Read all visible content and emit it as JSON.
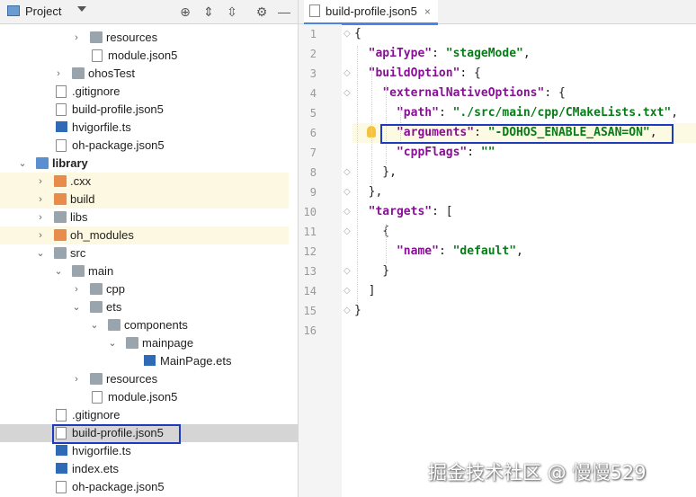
{
  "project_panel": {
    "title": "Project",
    "tree": [
      {
        "label": "resources",
        "type": "folder-grey",
        "arrow": "›"
      },
      {
        "label": "module.json5",
        "type": "json"
      },
      {
        "label": "ohosTest",
        "type": "folder-grey",
        "arrow": "›"
      },
      {
        "label": ".gitignore",
        "type": "git"
      },
      {
        "label": "build-profile.json5",
        "type": "json"
      },
      {
        "label": "hvigorfile.ts",
        "type": "ts"
      },
      {
        "label": "oh-package.json5",
        "type": "json"
      },
      {
        "label": "library",
        "type": "folder-blue",
        "arrow": "⌄",
        "bold": true
      },
      {
        "label": ".cxx",
        "type": "folder-orange",
        "arrow": "›",
        "highlight": true
      },
      {
        "label": "build",
        "type": "folder-orange",
        "arrow": "›",
        "highlight": true
      },
      {
        "label": "libs",
        "type": "folder-grey",
        "arrow": "›"
      },
      {
        "label": "oh_modules",
        "type": "folder-orange",
        "arrow": "›",
        "highlight": true
      },
      {
        "label": "src",
        "type": "folder-grey",
        "arrow": "⌄"
      },
      {
        "label": "main",
        "type": "folder-grey",
        "arrow": "⌄"
      },
      {
        "label": "cpp",
        "type": "folder-grey",
        "arrow": "›"
      },
      {
        "label": "ets",
        "type": "folder-grey",
        "arrow": "⌄"
      },
      {
        "label": "components",
        "type": "folder-grey",
        "arrow": "⌄"
      },
      {
        "label": "mainpage",
        "type": "folder-grey",
        "arrow": "⌄"
      },
      {
        "label": "MainPage.ets",
        "type": "ets"
      },
      {
        "label": "resources",
        "type": "folder-grey",
        "arrow": "›"
      },
      {
        "label": "module.json5",
        "type": "json"
      },
      {
        "label": ".gitignore",
        "type": "git"
      },
      {
        "label": "build-profile.json5",
        "type": "json",
        "selected": true
      },
      {
        "label": "hvigorfile.ts",
        "type": "ts"
      },
      {
        "label": "index.ets",
        "type": "ets"
      },
      {
        "label": "oh-package.json5",
        "type": "json"
      }
    ]
  },
  "editor": {
    "tab_label": "build-profile.json5",
    "tab_close": "×",
    "line_numbers": [
      "1",
      "2",
      "3",
      "4",
      "5",
      "6",
      "7",
      "8",
      "9",
      "10",
      "11",
      "12",
      "13",
      "14",
      "15",
      "16"
    ],
    "lines": [
      [
        {
          "t": "{",
          "c": "p"
        }
      ],
      [
        {
          "t": "  ",
          "c": "p"
        },
        {
          "t": "\"apiType\"",
          "c": "key"
        },
        {
          "t": ": ",
          "c": "p"
        },
        {
          "t": "\"stageMode\"",
          "c": "str"
        },
        {
          "t": ",",
          "c": "p"
        }
      ],
      [
        {
          "t": "  ",
          "c": "p"
        },
        {
          "t": "\"buildOption\"",
          "c": "key"
        },
        {
          "t": ": {",
          "c": "p"
        }
      ],
      [
        {
          "t": "    ",
          "c": "p"
        },
        {
          "t": "\"externalNativeOptions\"",
          "c": "key"
        },
        {
          "t": ": {",
          "c": "p"
        }
      ],
      [
        {
          "t": "      ",
          "c": "p"
        },
        {
          "t": "\"path\"",
          "c": "key"
        },
        {
          "t": ": ",
          "c": "p"
        },
        {
          "t": "\"./src/main/cpp/CMakeLists.txt\"",
          "c": "str"
        },
        {
          "t": ",",
          "c": "p"
        }
      ],
      [
        {
          "t": "      ",
          "c": "p"
        },
        {
          "t": "\"arguments\"",
          "c": "key"
        },
        {
          "t": ": ",
          "c": "p"
        },
        {
          "t": "\"-DOHOS_ENABLE_ASAN=ON\"",
          "c": "str"
        },
        {
          "t": ",",
          "c": "p"
        }
      ],
      [
        {
          "t": "      ",
          "c": "p"
        },
        {
          "t": "\"cppFlags\"",
          "c": "key"
        },
        {
          "t": ": ",
          "c": "p"
        },
        {
          "t": "\"\"",
          "c": "str"
        }
      ],
      [
        {
          "t": "    },",
          "c": "p"
        }
      ],
      [
        {
          "t": "  },",
          "c": "p"
        }
      ],
      [
        {
          "t": "  ",
          "c": "p"
        },
        {
          "t": "\"targets\"",
          "c": "key"
        },
        {
          "t": ": [",
          "c": "p"
        }
      ],
      [
        {
          "t": "    {",
          "c": "p"
        }
      ],
      [
        {
          "t": "      ",
          "c": "p"
        },
        {
          "t": "\"name\"",
          "c": "key"
        },
        {
          "t": ": ",
          "c": "p"
        },
        {
          "t": "\"default\"",
          "c": "str"
        },
        {
          "t": ",",
          "c": "p"
        }
      ],
      [
        {
          "t": "    }",
          "c": "p"
        }
      ],
      [
        {
          "t": "  ]",
          "c": "p"
        }
      ],
      [
        {
          "t": "}",
          "c": "p"
        }
      ],
      [
        {
          "t": "",
          "c": "p"
        }
      ]
    ]
  },
  "watermark": "掘金技术社区 @ 慢慢529"
}
